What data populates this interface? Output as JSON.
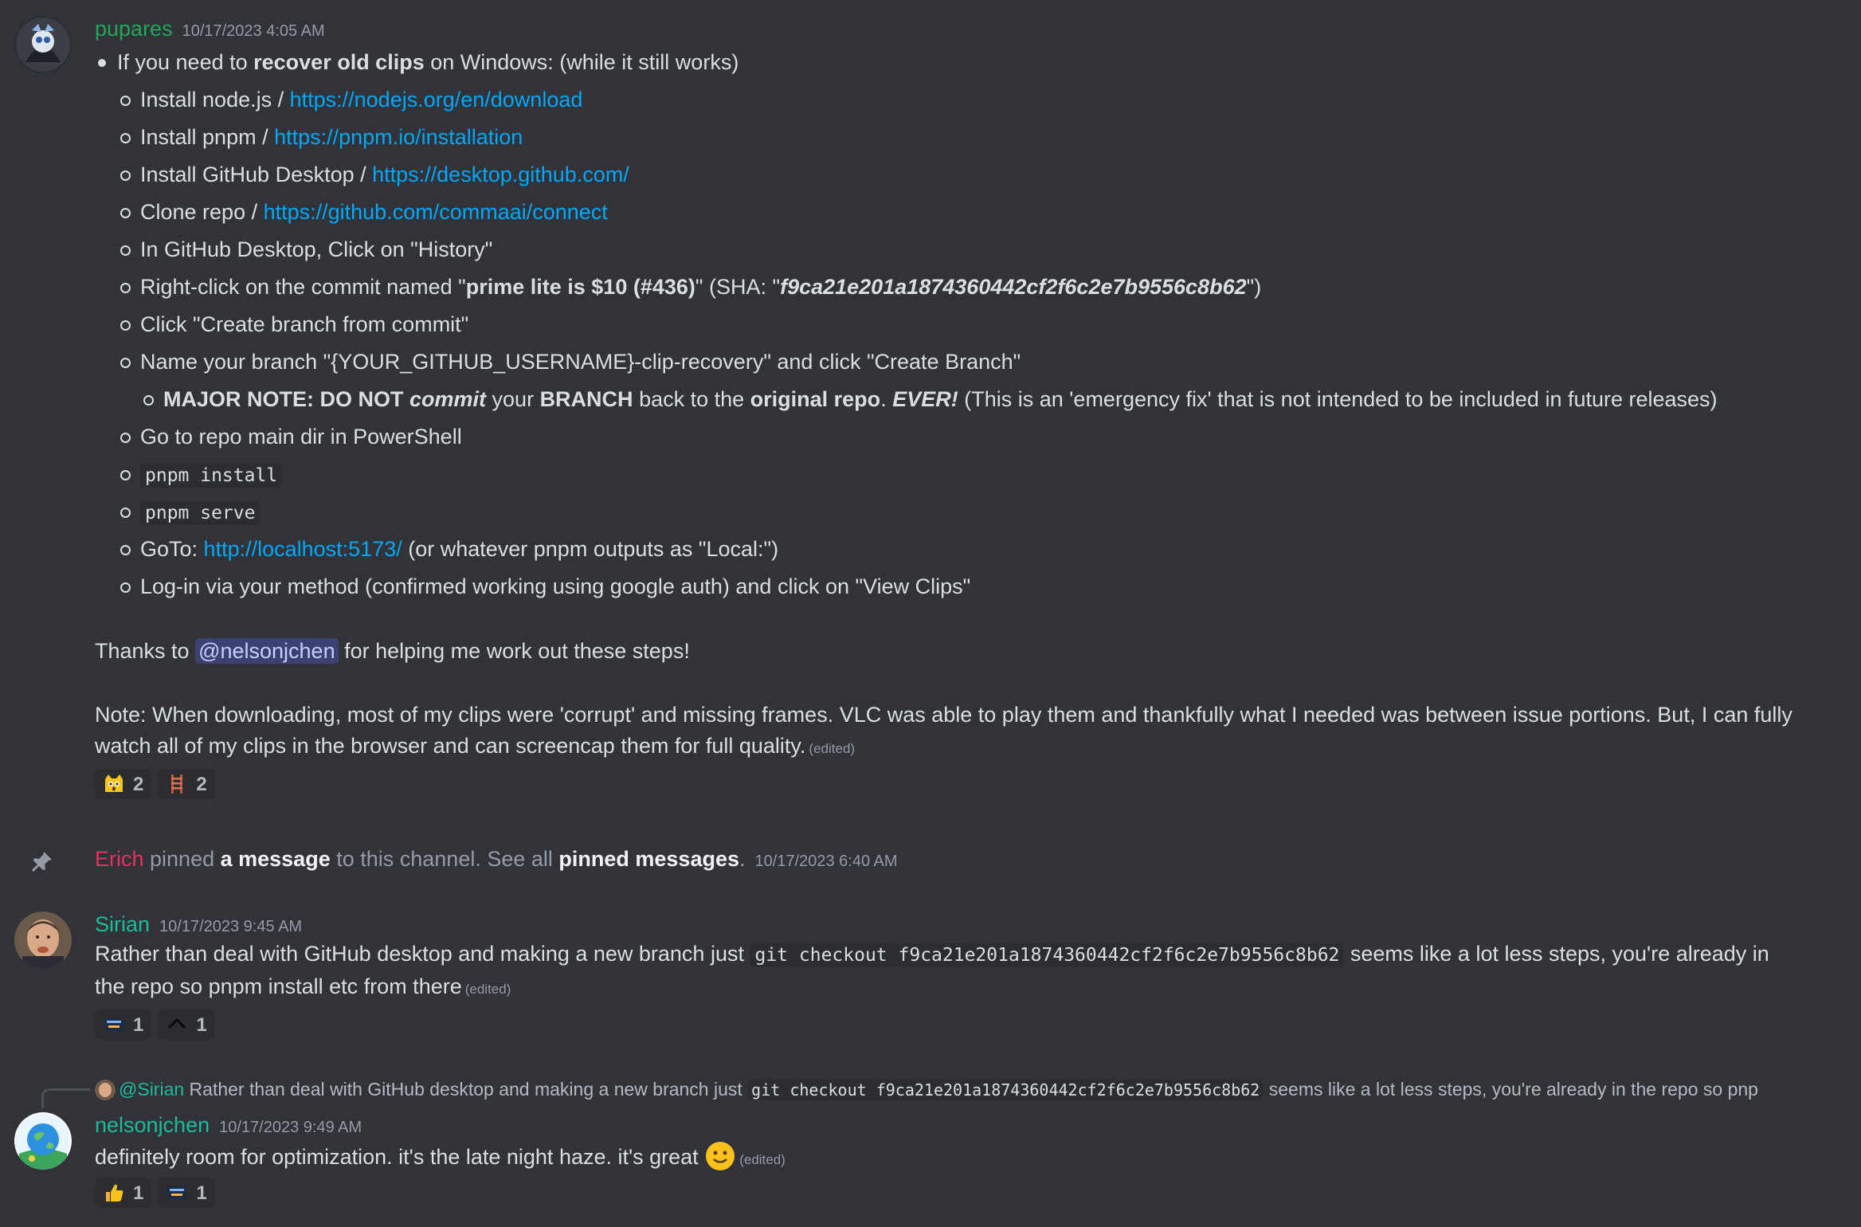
{
  "messages": [
    {
      "author": "pupares",
      "author_color": "#23a55a",
      "timestamp": "10/17/2023 4:05 AM",
      "list_intro_pre": "If you need to ",
      "list_intro_bold": "recover old clips",
      "list_intro_post": " on Windows: (while it still works)",
      "steps": {
        "s1_text": "Install node.js / ",
        "s1_link": "https://nodejs.org/en/download",
        "s2_text": "Install pnpm / ",
        "s2_link": "https://pnpm.io/installation",
        "s3_text": "Install GitHub Desktop / ",
        "s3_link": "https://desktop.github.com/",
        "s4_text": "Clone repo / ",
        "s4_link": "https://github.com/commaai/connect",
        "s5_text": "In GitHub Desktop, Click on \"History\"",
        "s6_pre": "Right-click on the commit named \"",
        "s6_bold": "prime lite is $10 (#436)",
        "s6_mid": "\" (SHA: \"",
        "s6_sha": "f9ca21e201a1874360442cf2f6c2e7b9556c8b62",
        "s6_post": "\")",
        "s7_text": "Click \"Create branch from commit\"",
        "s8_text": "Name your branch \"{YOUR_GITHUB_USERNAME}-clip-recovery\" and click \"Create Branch\"",
        "note_major": "MAJOR NOTE: DO NOT ",
        "note_commit": "commit",
        "note_your": " your ",
        "note_branch": "BRANCH",
        "note_back": " back to the ",
        "note_orig": "original repo",
        "note_dot": ". ",
        "note_ever": "EVER!",
        "note_post": " (This is an 'emergency fix' that is not intended to be included in future releases)",
        "s9_text": "Go to repo main dir in PowerShell",
        "s10_code": "pnpm install",
        "s11_code": "pnpm serve",
        "s12_pre": "GoTo: ",
        "s12_link": "http://localhost:5173/",
        "s12_post": " (or whatever pnpm outputs as \"Local:\")",
        "s13_text": "Log-in via your method (confirmed working using google auth) and click on \"View Clips\""
      },
      "thanks_pre": "Thanks to ",
      "thanks_mention": "@nelsonjchen",
      "thanks_post": " for helping me work out these steps!",
      "note_line1": "Note: When downloading, most of my clips were 'corrupt' and missing frames. VLC was able to play them and thankfully what I needed was between issue portions. But, I can fully",
      "note_line2": "watch all of my clips in the browser and can screencap them for full quality.",
      "edited": "(edited)",
      "reactions": [
        {
          "icon": "surprised-cat-emoji-icon",
          "count": "2"
        },
        {
          "icon": "ladder-emoji-icon",
          "count": "2"
        }
      ]
    },
    {
      "type": "pin-notice",
      "pinner": "Erich",
      "pinner_color": "#e4335f",
      "text1": " pinned ",
      "link1": "a message",
      "text2": " to this channel. See all ",
      "link2": "pinned messages",
      "text3": ".",
      "timestamp": "10/17/2023 6:40 AM"
    },
    {
      "author": "Sirian",
      "author_color": "#1abc9c",
      "timestamp": "10/17/2023 9:45 AM",
      "line1_pre": "Rather than deal with GitHub desktop and making a new branch just ",
      "line1_code": "git checkout f9ca21e201a1874360442cf2f6c2e7b9556c8b62",
      "line1_post": " seems like a lot less steps, you're already in",
      "line2": "the repo so pnpm install etc from there",
      "edited": "(edited)",
      "reactions": [
        {
          "icon": "thank-you-emoji-icon",
          "count": "1"
        },
        {
          "icon": "caret-up-emoji-icon",
          "count": "1"
        }
      ]
    },
    {
      "author": "nelsonjchen",
      "author_color": "#1abc9c",
      "timestamp": "10/17/2023 9:49 AM",
      "reply": {
        "author": "@Sirian",
        "pre": " Rather than deal with GitHub desktop and making a new branch just ",
        "code": "git checkout f9ca21e201a1874360442cf2f6c2e7b9556c8b62",
        "post": " seems like a lot less steps, you're already in the repo so pnp"
      },
      "text": "definitely room for optimization. it's the late night haze. it's great ",
      "edited": "(edited)",
      "reactions": [
        {
          "icon": "thumbs-up-emoji-icon",
          "count": "1"
        },
        {
          "icon": "thank-you-emoji-icon",
          "count": "1"
        }
      ]
    }
  ]
}
